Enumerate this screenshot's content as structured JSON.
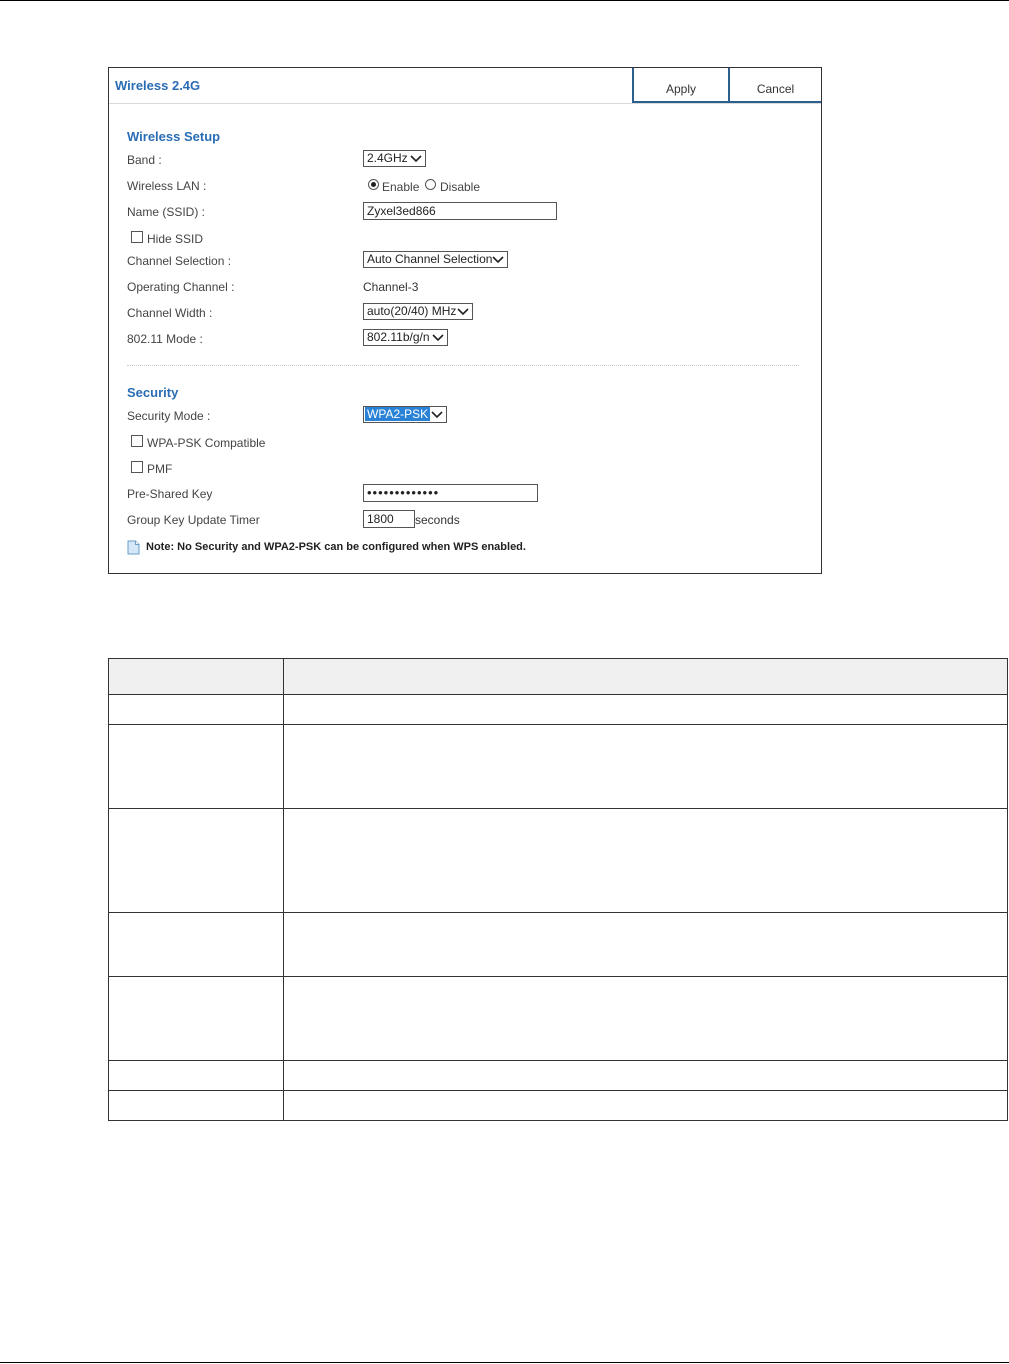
{
  "panel": {
    "title": "Wireless 2.4G",
    "apply_label": "Apply",
    "cancel_label": "Cancel"
  },
  "wireless_setup": {
    "section_title": "Wireless Setup",
    "band": {
      "label": "Band :",
      "value": "2.4GHz"
    },
    "wireless_lan": {
      "label": "Wireless LAN :",
      "options": [
        "Enable",
        "Disable"
      ],
      "selected": "Enable"
    },
    "ssid": {
      "label": "Name (SSID) :",
      "value": "Zyxel3ed866"
    },
    "hide_ssid": {
      "label": "Hide SSID",
      "checked": false
    },
    "channel_selection": {
      "label": "Channel Selection :",
      "value": "Auto Channel Selection"
    },
    "operating_channel": {
      "label": "Operating Channel :",
      "value": "Channel-3"
    },
    "channel_width": {
      "label": "Channel Width :",
      "value": "auto(20/40) MHz"
    },
    "mode_80211": {
      "label": "802.11 Mode :",
      "value": "802.11b/g/n"
    }
  },
  "security": {
    "section_title": "Security",
    "security_mode": {
      "label": "Security Mode :",
      "value": "WPA2-PSK"
    },
    "wpa_psk_compatible": {
      "label": "WPA-PSK Compatible",
      "checked": false
    },
    "pmf": {
      "label": "PMF",
      "checked": false
    },
    "pre_shared_key": {
      "label": "Pre-Shared Key",
      "value": "•••••••••••••"
    },
    "group_key_timer": {
      "label": "Group Key Update Timer",
      "value": "1800",
      "unit": "seconds"
    }
  },
  "note": "Note: No Security and WPA2-PSK can be configured when WPS enabled.",
  "colors": {
    "title_blue": "#2a6db5",
    "button_border": "#2b5f8f",
    "selection_highlight": "#2a82d6",
    "table_header_bg": "#f0f0f0"
  },
  "icons": {
    "note": "note-document-icon",
    "dropdown": "chevron-down-icon"
  }
}
